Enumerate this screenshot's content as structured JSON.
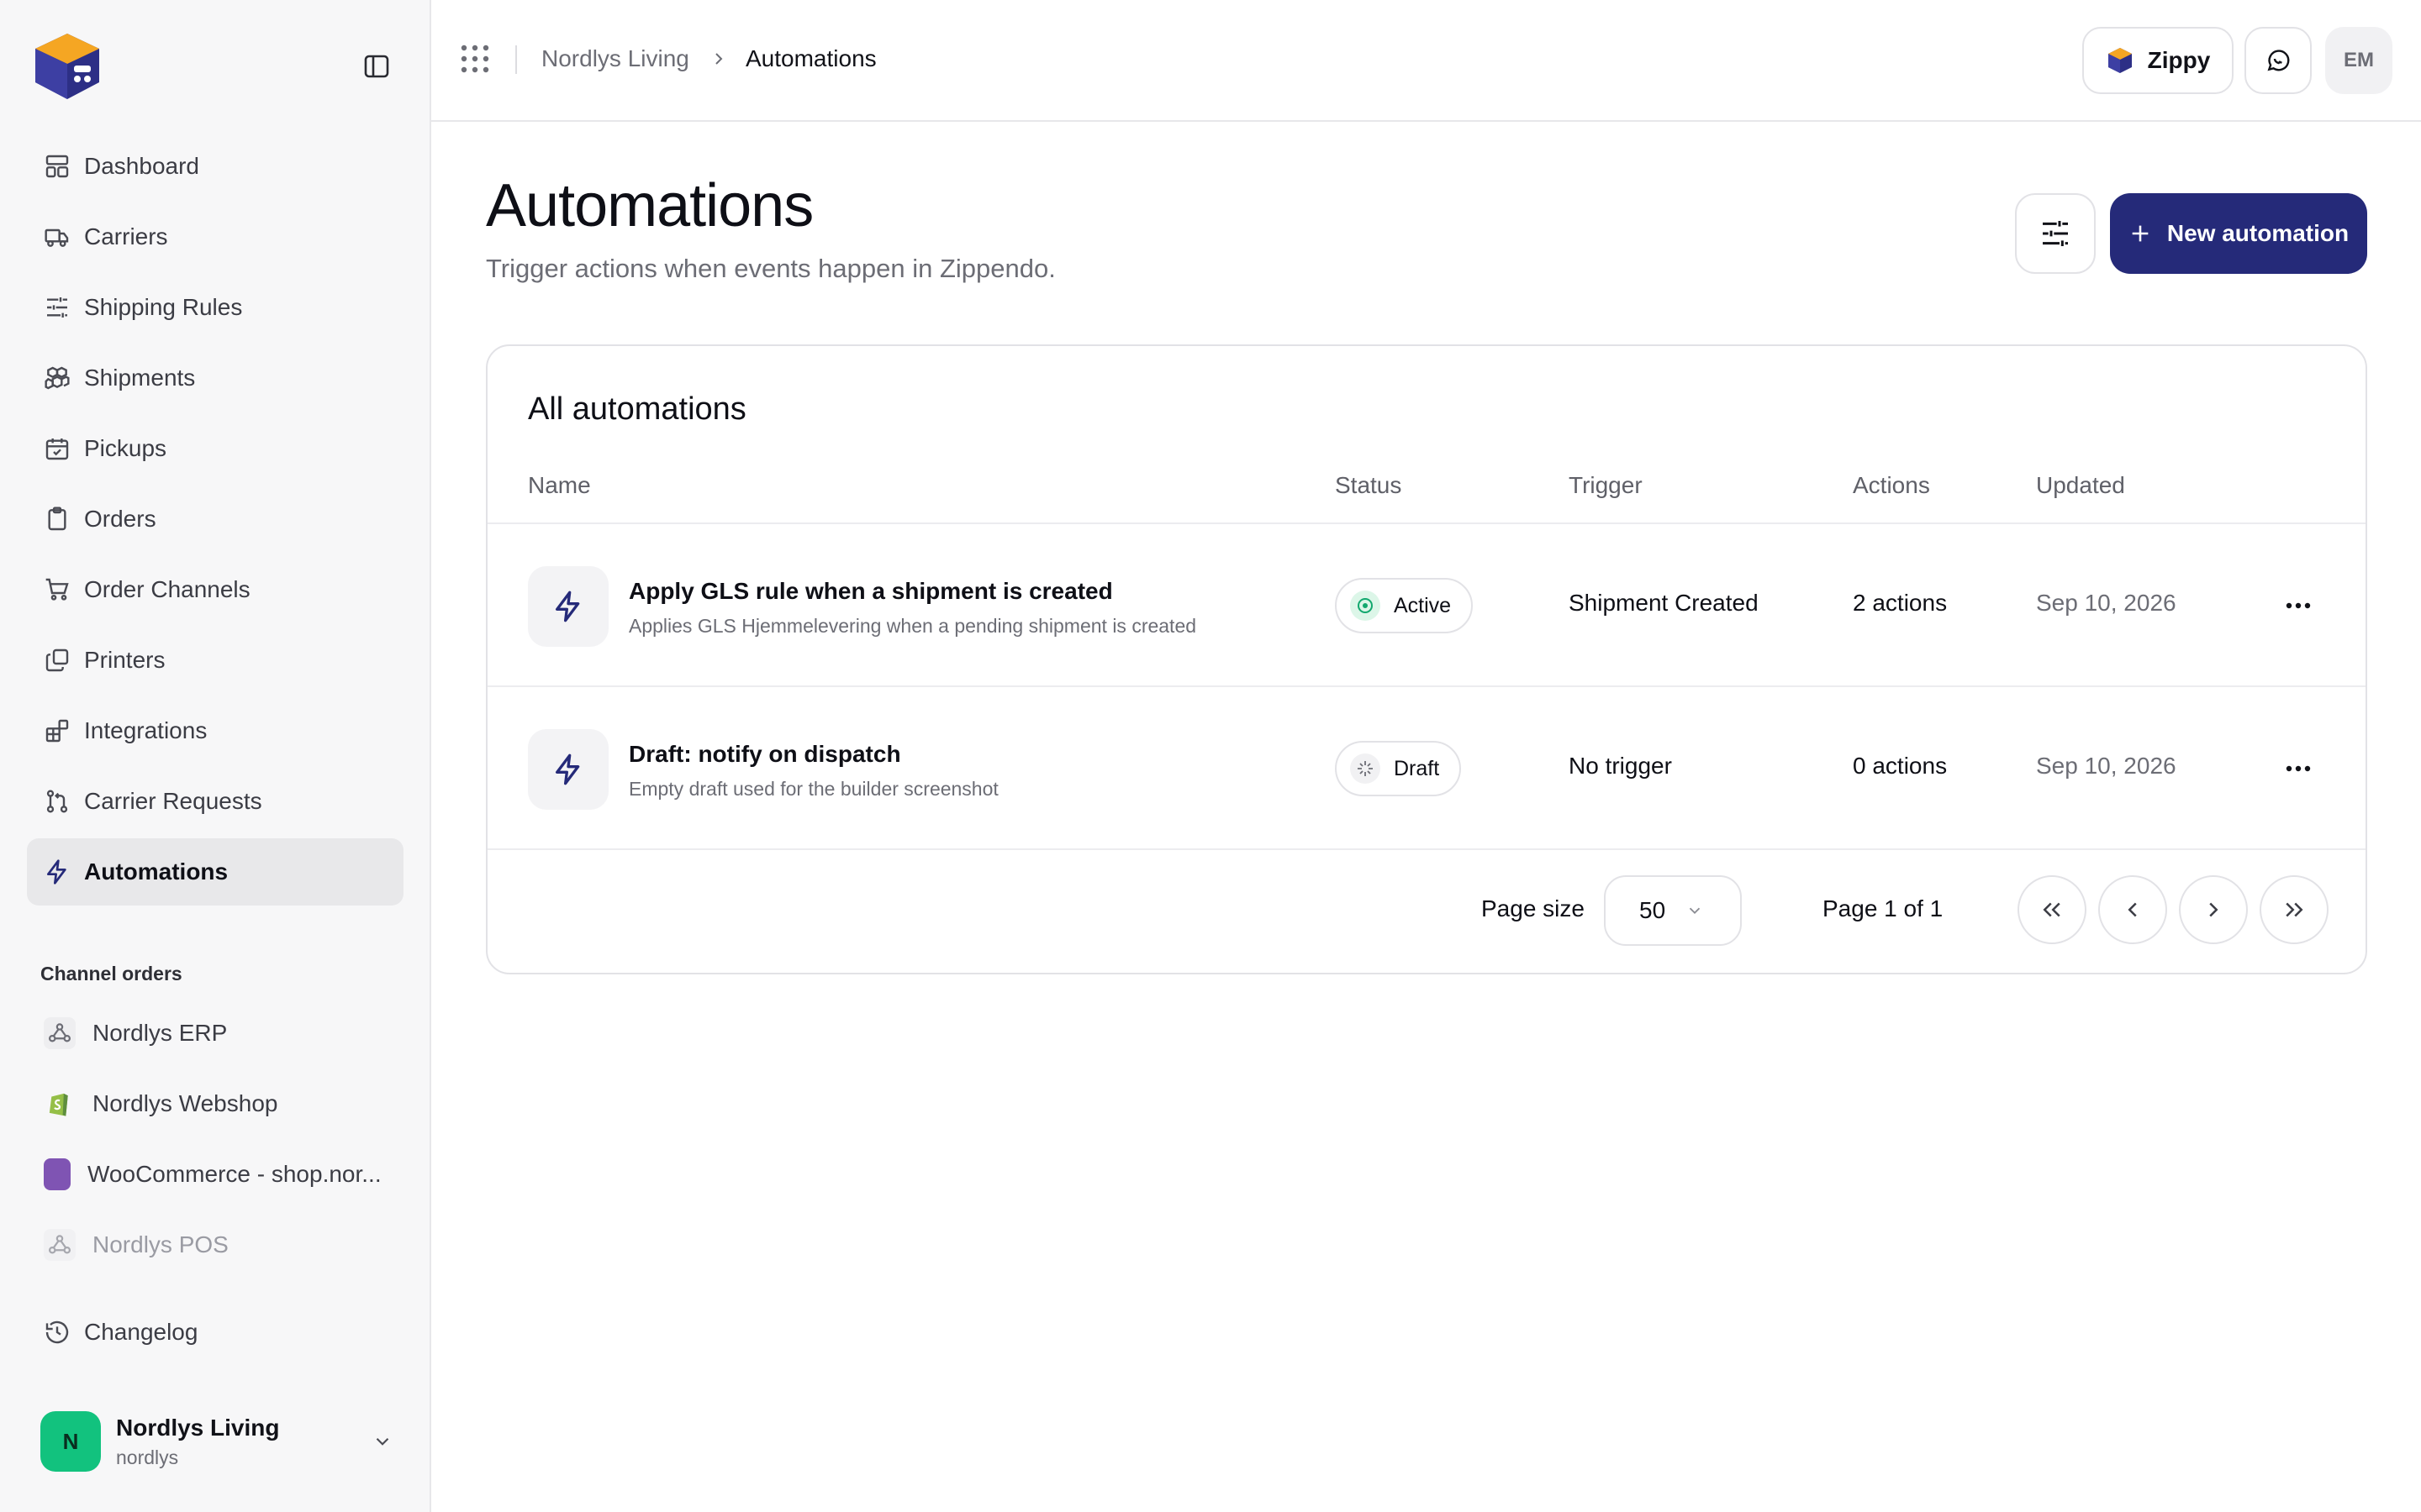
{
  "sidebar": {
    "nav": [
      {
        "label": "Dashboard",
        "icon": "dashboard-icon"
      },
      {
        "label": "Carriers",
        "icon": "truck-icon"
      },
      {
        "label": "Shipping Rules",
        "icon": "sliders-icon"
      },
      {
        "label": "Shipments",
        "icon": "boxes-icon"
      },
      {
        "label": "Pickups",
        "icon": "calendar-check-icon"
      },
      {
        "label": "Orders",
        "icon": "clipboard-icon"
      },
      {
        "label": "Order Channels",
        "icon": "cart-icon"
      },
      {
        "label": "Printers",
        "icon": "printer-copy-icon"
      },
      {
        "label": "Integrations",
        "icon": "blocks-icon"
      },
      {
        "label": "Carrier Requests",
        "icon": "git-pull-icon"
      },
      {
        "label": "Automations",
        "icon": "bolt-icon",
        "active": true
      }
    ],
    "channels_title": "Channel orders",
    "channels": [
      {
        "label": "Nordlys ERP",
        "icon": "webhook-icon"
      },
      {
        "label": "Nordlys Webshop",
        "icon": "shopify-icon"
      },
      {
        "label": "WooCommerce - shop.nor...",
        "icon": "woocommerce-icon"
      },
      {
        "label": "Nordlys POS",
        "icon": "webhook-icon",
        "disabled": true
      }
    ],
    "changelog": "Changelog",
    "org": {
      "initial": "N",
      "name": "Nordlys Living",
      "slug": "nordlys"
    }
  },
  "topbar": {
    "breadcrumb": [
      "Nordlys Living",
      "Automations"
    ],
    "zippy_label": "Zippy",
    "avatar_initials": "EM"
  },
  "page": {
    "title": "Automations",
    "subtitle": "Trigger actions when events happen in Zippendo.",
    "new_button": "New automation"
  },
  "table": {
    "title": "All automations",
    "columns": [
      "Name",
      "Status",
      "Trigger",
      "Actions",
      "Updated"
    ],
    "rows": [
      {
        "name": "Apply GLS rule when a shipment is created",
        "description": "Applies GLS Hjemmelevering when a pending shipment is created",
        "status": "Active",
        "trigger": "Shipment Created",
        "actions": "2 actions",
        "updated": "Sep 10, 2026"
      },
      {
        "name": "Draft: notify on dispatch",
        "description": "Empty draft used for the builder screenshot",
        "status": "Draft",
        "trigger": "No trigger",
        "actions": "0 actions",
        "updated": "Sep 10, 2026"
      }
    ],
    "pager": {
      "page_size_label": "Page size",
      "page_size": "50",
      "page_info": "Page 1 of 1"
    }
  },
  "colors": {
    "primary": "#252a79",
    "active_green": "#12c27e",
    "sidebar_bg": "#f7f7f8"
  }
}
